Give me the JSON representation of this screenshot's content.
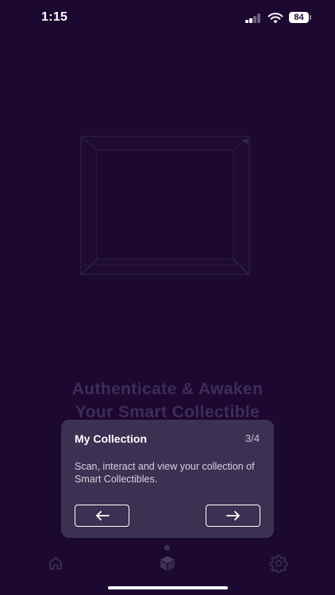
{
  "status_bar": {
    "time": "1:15",
    "battery": "84",
    "icons": [
      "signal-icon",
      "wifi-icon",
      "battery-icon"
    ]
  },
  "hero": {
    "headline_line1": "Authenticate & Awaken",
    "headline_line2": "Your Smart Collectible"
  },
  "tooltip": {
    "title": "My Collection",
    "step": "3/4",
    "description": "Scan, interact and view your collection of Smart Collectibles.",
    "prev_icon": "arrow-left-icon",
    "next_icon": "arrow-right-icon"
  },
  "tab_bar": {
    "tabs": [
      {
        "icon": "home-icon",
        "active": false
      },
      {
        "icon": "cube-icon",
        "active": true
      },
      {
        "icon": "gear-icon",
        "active": false
      }
    ]
  },
  "colors": {
    "background": "#1c0830",
    "card": "#3b3152",
    "headline": "#3f2d57",
    "inactive_icon": "#3e3152"
  }
}
